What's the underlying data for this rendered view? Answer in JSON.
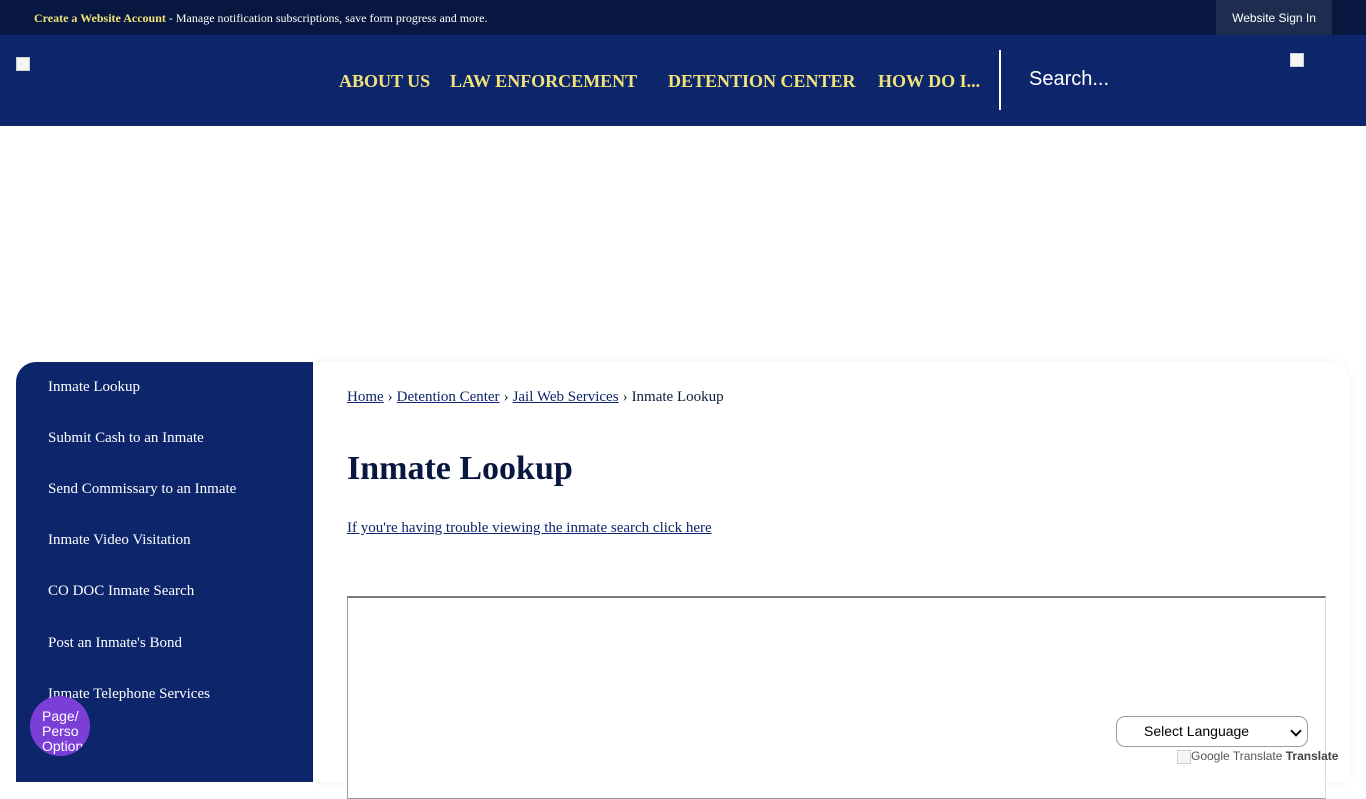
{
  "topbar": {
    "create_link": "Create a Website Account",
    "message": " - Manage notification subscriptions, save form progress and more.",
    "signin_label": "Website Sign In"
  },
  "nav": {
    "items": [
      {
        "label": "ABOUT US"
      },
      {
        "label": "LAW ENFORCEMENT"
      },
      {
        "label": "DETENTION CENTER"
      },
      {
        "label": "HOW DO I..."
      }
    ],
    "search_placeholder": "Search..."
  },
  "sidebar": {
    "items": [
      {
        "label": "Inmate Lookup"
      },
      {
        "label": "Submit Cash to an Inmate"
      },
      {
        "label": "Send Commissary to an Inmate"
      },
      {
        "label": "Inmate Video Visitation"
      },
      {
        "label": "CO DOC Inmate Search"
      },
      {
        "label": "Post an Inmate's Bond"
      },
      {
        "label": "Inmate Telephone Services"
      }
    ]
  },
  "breadcrumb": {
    "items": [
      "Home",
      "Detention Center",
      "Jail Web Services"
    ],
    "current": "Inmate Lookup"
  },
  "main": {
    "title": "Inmate Lookup",
    "trouble_link": "If you're having trouble viewing the inmate search click here"
  },
  "translate": {
    "select_label": "Select Language",
    "google_alt": "Google Translate",
    "translate_label": "Translate"
  },
  "page_options": {
    "label": "Page/ Perso Option"
  },
  "colors": {
    "topbar": "#07173f",
    "header": "#0c256b",
    "nav_text": "#f1e27a",
    "accent_bubble": "#7b3fd8"
  }
}
